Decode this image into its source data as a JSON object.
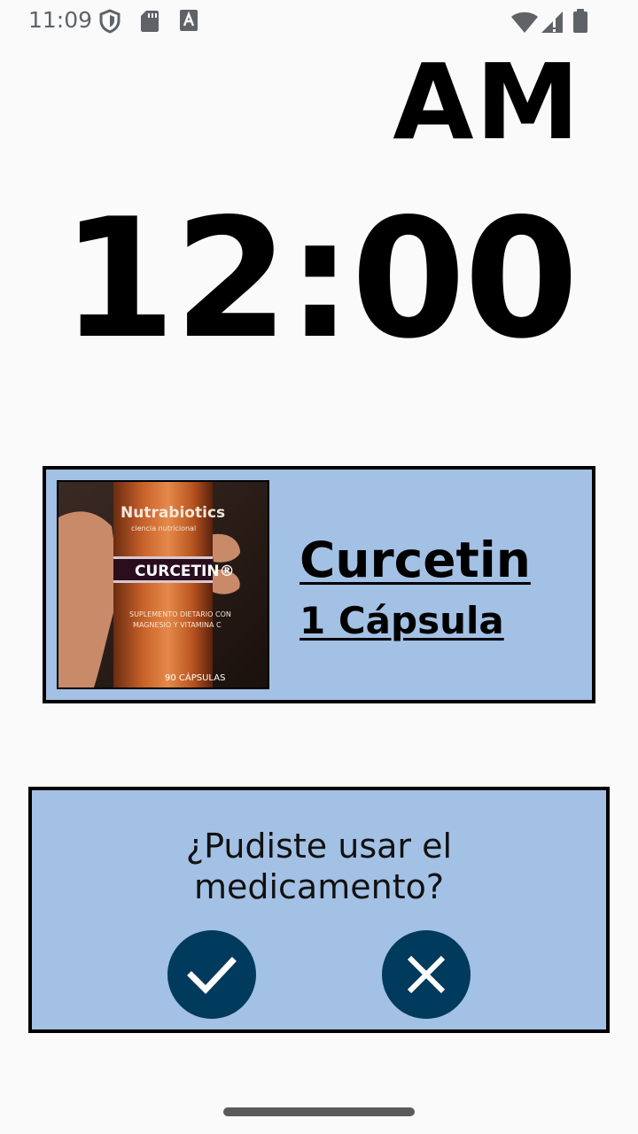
{
  "status_bar": {
    "time": "11:09",
    "left_icons": [
      "shield-icon",
      "sd-card-icon",
      "font-a-icon"
    ],
    "right_icons": [
      "wifi-icon",
      "signal-icon",
      "battery-icon"
    ]
  },
  "alarm": {
    "period": "AM",
    "time": "12:00"
  },
  "medication": {
    "name": "Curcetin",
    "dose": "1 Cápsula",
    "photo_brand": "Nutrabiotics",
    "photo_tagline": "ciencia nutricional",
    "photo_product": "CURCETIN®",
    "photo_line1": "SUPLEMENTO DIETARIO CON",
    "photo_line2": "MAGNESIO Y VITAMINA C",
    "photo_count": "90 CÁPSULAS"
  },
  "question": {
    "line1": "¿Pudiste usar el",
    "line2": "medicamento?",
    "yes_icon": "check-icon",
    "no_icon": "close-icon"
  },
  "colors": {
    "card_bg": "#a3c1e4",
    "button_bg": "#003a5c",
    "border": "#000000"
  }
}
